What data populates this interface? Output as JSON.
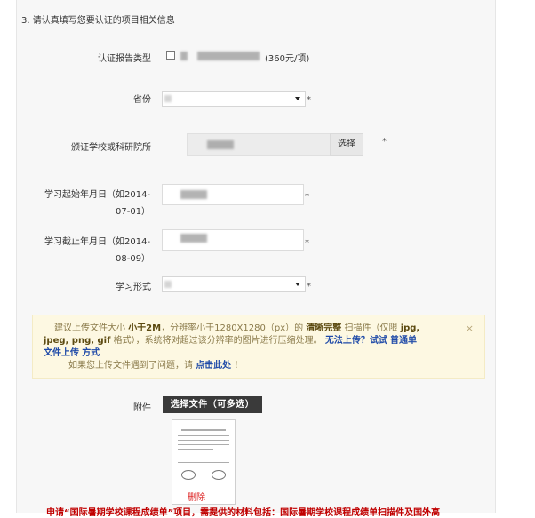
{
  "section": {
    "title": "3. 请认真填写您要认证的项目相关信息"
  },
  "report_type": {
    "label": "认证报告类型",
    "price": "(360元/项)"
  },
  "province": {
    "label": "省份",
    "required": "*"
  },
  "school": {
    "label": "颁证学校或科研院所",
    "choose_label": "选择",
    "required": "*"
  },
  "start_date": {
    "label_line1": "学习起始年月日（如2014-",
    "label_line2": "07-01）",
    "required": "*"
  },
  "end_date": {
    "label_line1": "学习截止年月日（如2014-",
    "label_line2": "08-09）",
    "required": "*"
  },
  "study_form": {
    "label": "学习形式",
    "required": "*"
  },
  "notice": {
    "part1": "建议上传文件大小",
    "size_limit": "小于2M",
    "part2": "，分辨率小于1280X1280（px）的",
    "clarity": "清晰完整",
    "part3": "扫描件（仅限",
    "formats": "jpg,",
    "formats2": "jpeg, png, gif",
    "part4": "格式），系统将对超过该分辨率的图片进行压缩处理。",
    "cant_upload": "无法上传？试试",
    "normal_upload": "普通单",
    "normal_upload2": "文件上传",
    "method": "方式",
    "part5": "如果您上传文件遇到了问题，请",
    "click_here": "点击此处",
    "part6": "！",
    "close": "×"
  },
  "attachment": {
    "label": "附件",
    "button": "选择文件（可多选）",
    "delete": "删除"
  },
  "bottom_note": "申请“国际暑期学校课程成绩单”项目，需提供的材料包括：国际暑期学校课程成绩单扫描件及国外高"
}
